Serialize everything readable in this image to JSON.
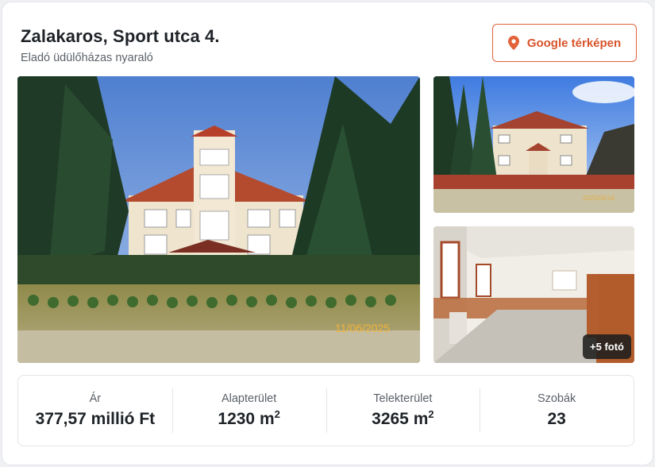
{
  "listing": {
    "title": "Zalakaros, Sport utca 4.",
    "subtitle": "Eladó üdülőházas nyaraló"
  },
  "map_button": {
    "label": "Google térképen",
    "icon": "map-pin-icon",
    "color": "#d9542b"
  },
  "gallery": {
    "main_photo_date_stamp": "11/06/2025",
    "side_photo_date_stamp": "2025/06/16",
    "more_photos_label": "+5 fotó"
  },
  "stats": [
    {
      "label": "Ár",
      "value": "377,57 millió Ft",
      "unit_sup": ""
    },
    {
      "label": "Alapterület",
      "value": "1230 m",
      "unit_sup": "2"
    },
    {
      "label": "Telekterület",
      "value": "3265 m",
      "unit_sup": "2"
    },
    {
      "label": "Szobák",
      "value": "23",
      "unit_sup": ""
    }
  ]
}
